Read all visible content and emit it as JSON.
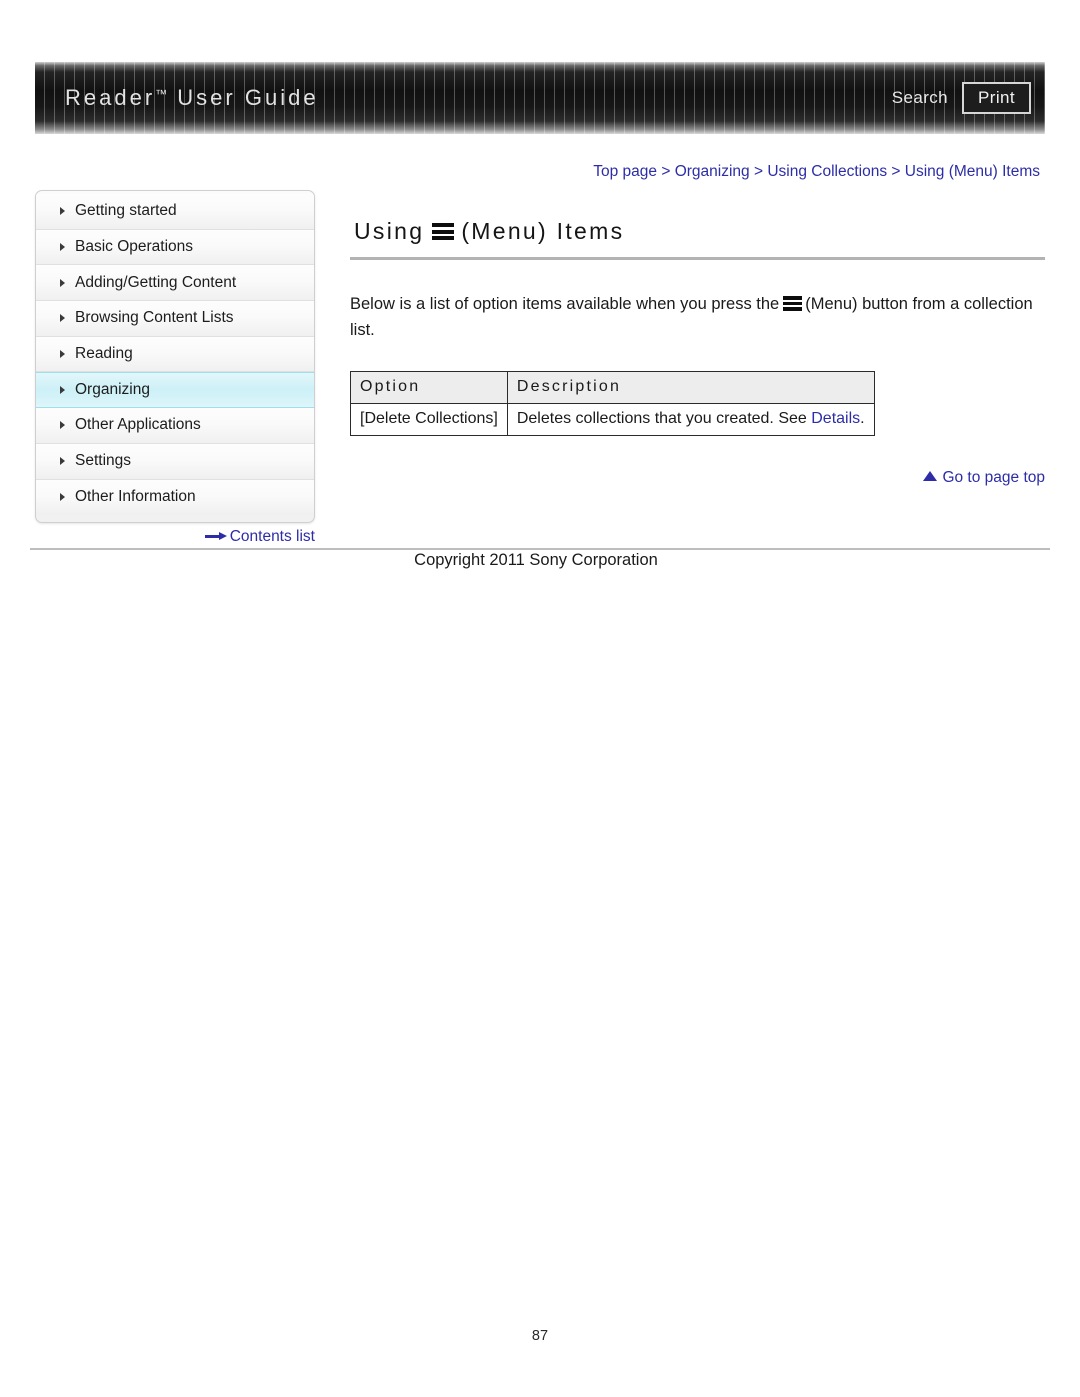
{
  "header": {
    "title": "Reader",
    "trademark": "™",
    "title_suffix": "User Guide",
    "search_label": "Search",
    "print_label": "Print"
  },
  "breadcrumb": {
    "separator": " > ",
    "items": [
      {
        "label": "Top page"
      },
      {
        "label": "Organizing"
      },
      {
        "label": "Using Collections"
      },
      {
        "label": "Using (Menu) Items"
      }
    ]
  },
  "sidebar": {
    "items": [
      {
        "label": "Getting started",
        "active": false
      },
      {
        "label": "Basic Operations",
        "active": false
      },
      {
        "label": "Adding/Getting Content",
        "active": false
      },
      {
        "label": "Browsing Content Lists",
        "active": false
      },
      {
        "label": "Reading",
        "active": false
      },
      {
        "label": "Organizing",
        "active": true
      },
      {
        "label": "Other Applications",
        "active": false
      },
      {
        "label": "Settings",
        "active": false
      },
      {
        "label": "Other Information",
        "active": false
      }
    ],
    "contents_list_label": "Contents list"
  },
  "main": {
    "title_prefix": "Using",
    "title_suffix": "(Menu) Items",
    "intro_part1": "Below is a list of option items available when you press the",
    "intro_part2": "(Menu) button from a collection list.",
    "table": {
      "headers": [
        "Option",
        "Description"
      ],
      "rows": [
        {
          "option": "[Delete Collections]",
          "description_before": "Deletes collections that you created. See ",
          "description_link": "Details",
          "description_after": "."
        }
      ]
    },
    "go_to_top_label": "Go to page top"
  },
  "footer": {
    "copyright": "Copyright 2011 Sony Corporation",
    "page_number": "87"
  },
  "colors": {
    "link": "#2d2da8",
    "highlight": "#cdf0f7",
    "banner": "#151515",
    "table_header_bg": "#ededed"
  }
}
